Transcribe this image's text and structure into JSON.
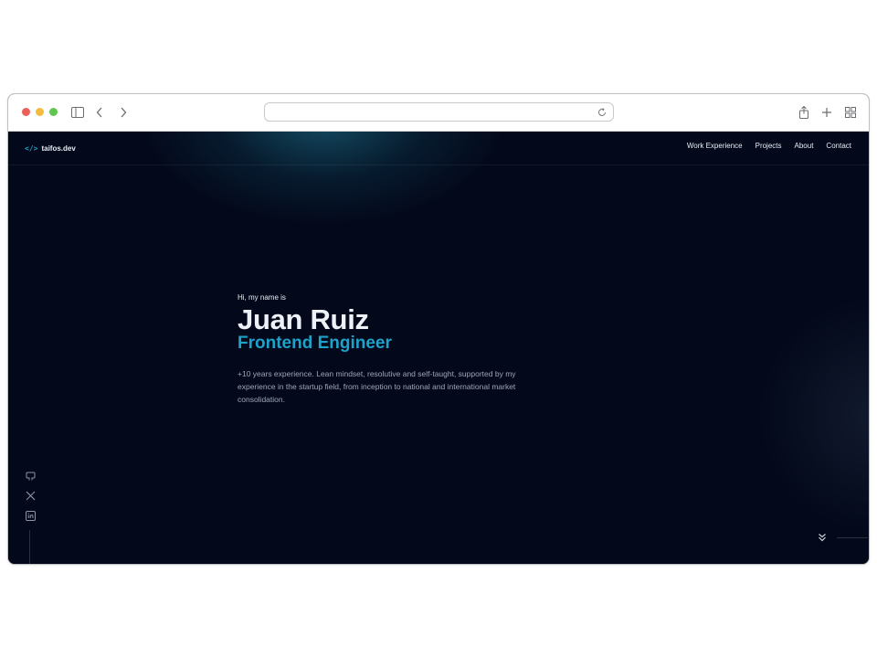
{
  "browser": {
    "url": "",
    "icons": [
      "sidebar-icon",
      "back-icon",
      "forward-icon",
      "reload-icon",
      "share-icon",
      "new-tab-icon",
      "tab-overview-icon"
    ]
  },
  "site": {
    "logo_glyph": "</>",
    "logo_text": "taifos.dev",
    "nav": [
      "Work Experience",
      "Projects",
      "About",
      "Contact"
    ]
  },
  "hero": {
    "greeting": "Hi, my name is",
    "name": "Juan Ruiz",
    "role": "Frontend Engineer",
    "description": "+10 years experience. Lean mindset, resolutive and self-taught, supported by my experience in the startup field, from inception to national and international market consolidation."
  },
  "social": [
    "github-icon",
    "x-icon",
    "linkedin-icon"
  ],
  "colors": {
    "background": "#03091b",
    "accent": "#1ea2c9",
    "text": "#e8ecf3",
    "muted": "#9ea7b6"
  }
}
